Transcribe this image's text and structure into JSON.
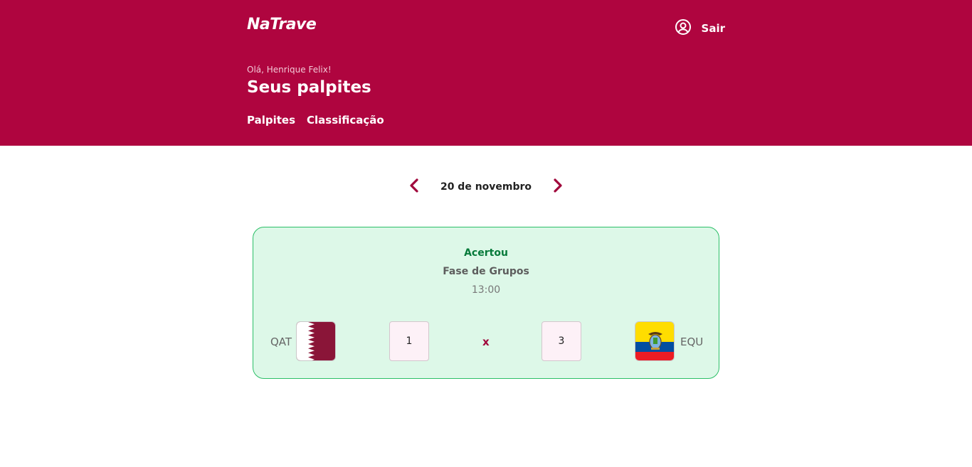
{
  "header": {
    "logo": "NaTrave",
    "logout_label": "Sair",
    "greeting": "Olá, Henrique Felix!",
    "title": "Seus palpites",
    "tabs": [
      {
        "label": "Palpites"
      },
      {
        "label": "Classificação"
      }
    ]
  },
  "date_nav": {
    "date": "20 de novembro",
    "prev_icon": "chevron-left-icon",
    "next_icon": "chevron-right-icon"
  },
  "match": {
    "status": "Acertou",
    "phase": "Fase de Grupos",
    "time": "13:00",
    "home": {
      "code": "QAT",
      "score": "1",
      "flag": "qatar-flag-icon"
    },
    "away": {
      "code": "EQU",
      "score": "3",
      "flag": "ecuador-flag-icon"
    },
    "separator": "x"
  },
  "colors": {
    "brand": "#af053f",
    "success_bg": "#ddf8e8",
    "success_border": "#2bbf67",
    "success_text": "#067a3a"
  }
}
